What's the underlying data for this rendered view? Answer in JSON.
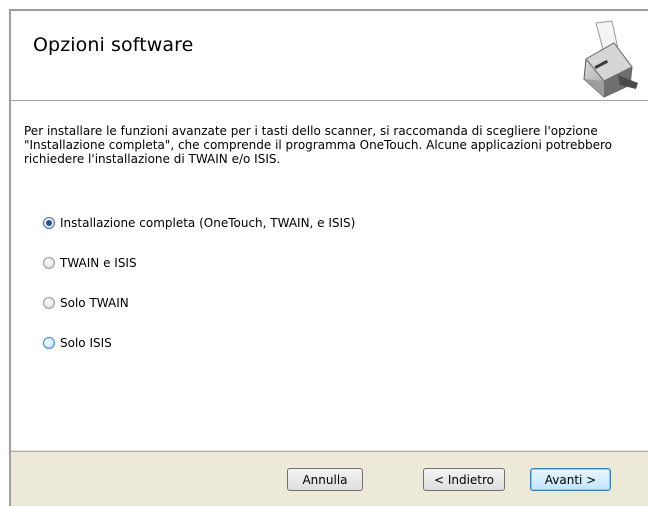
{
  "header": {
    "title": "Opzioni software",
    "icon": "scanner-icon"
  },
  "body": {
    "intro": "Per installare le funzioni avanzate per i tasti dello scanner, si raccomanda di scegliere l'opzione \"Installazione completa\", che comprende il programma OneTouch. Alcune applicazioni potrebbero richiedere l'installazione di TWAIN e/o ISIS.",
    "options": [
      {
        "label": "Installazione completa (OneTouch, TWAIN, e ISIS)",
        "selected": true
      },
      {
        "label": "TWAIN e ISIS",
        "selected": false
      },
      {
        "label": "Solo TWAIN",
        "selected": false
      },
      {
        "label": "Solo ISIS",
        "selected": false,
        "hovered": true
      }
    ]
  },
  "footer": {
    "cancel_label": "Annulla",
    "back_label": "< Indietro",
    "next_label": "Avanti >"
  },
  "colors": {
    "dialog_bg": "#ece9d8",
    "selected_dot": "#2c4f84",
    "default_button_border": "#3c7fb1"
  }
}
